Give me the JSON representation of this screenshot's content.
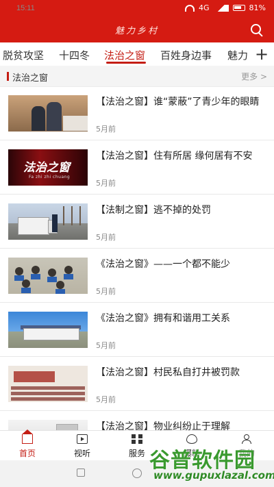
{
  "status_bar": {
    "time": "15:11",
    "network": "4G",
    "battery": "81%"
  },
  "header": {
    "app_name": "魅力乡村",
    "icons": {
      "search": "search-icon"
    }
  },
  "tabs": [
    {
      "label": "脱贫攻坚",
      "active": false
    },
    {
      "label": "十四冬",
      "active": false
    },
    {
      "label": "法治之窗",
      "active": true
    },
    {
      "label": "百姓身边事",
      "active": false
    },
    {
      "label": "魅力",
      "active": false
    }
  ],
  "add_tab_icon": "plus-icon",
  "section": {
    "title": "法治之窗",
    "more": "更多 >"
  },
  "articles": [
    {
      "title": "【法治之窗】谁“蒙蔽”了青少年的眼睛",
      "time": "5月前"
    },
    {
      "title": "【法治之窗】住有所居 缘何居有不安",
      "time": "5月前",
      "thumb_text": "法治之窗",
      "thumb_sub": "Fa zhi zhi chuang"
    },
    {
      "title": "【法制之窗】逃不掉的处罚",
      "time": "5月前"
    },
    {
      "title": "《法治之窗》——一个都不能少",
      "time": "5月前"
    },
    {
      "title": "《法治之窗》拥有和谐用工关系",
      "time": "5月前"
    },
    {
      "title": "【法治之窗】村民私自打井被罚款",
      "time": "5月前"
    },
    {
      "title": "【法治之窗】物业纠纷止于理解",
      "time": ""
    }
  ],
  "bottom_nav": [
    {
      "label": "首页",
      "icon": "home-icon",
      "active": true
    },
    {
      "label": "视听",
      "icon": "tv-icon",
      "active": false
    },
    {
      "label": "服务",
      "icon": "grid-icon",
      "active": false
    },
    {
      "label": "爆料",
      "icon": "fire-icon",
      "active": false
    },
    {
      "label": "我的",
      "icon": "user-icon",
      "active": false
    }
  ],
  "watermark": {
    "text": "谷普软件园",
    "url": "www.gupuxlazal.com"
  },
  "colors": {
    "brand": "#d51b12",
    "accent": "#c41d14"
  }
}
